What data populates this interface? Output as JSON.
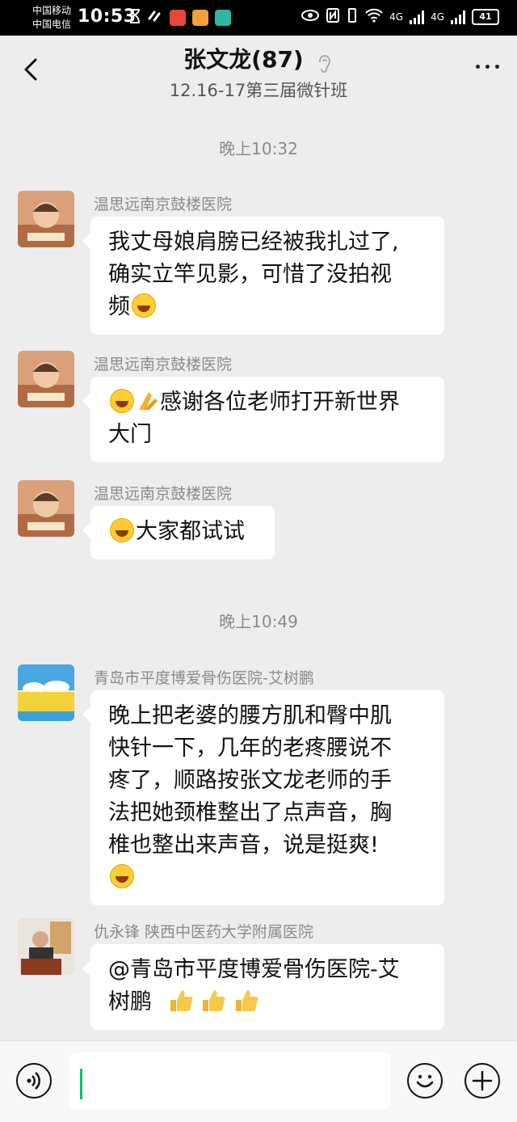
{
  "status_bar": {
    "carrier_1": "中国移动",
    "carrier_2": "中国电信",
    "time": "10:53",
    "network_1": "4G",
    "network_2": "4G",
    "battery": "41"
  },
  "header": {
    "title": "张文龙(87)",
    "subtitle": "12.16-17第三届微针班"
  },
  "timestamps": [
    "晚上10:32",
    "晚上10:49"
  ],
  "messages": [
    {
      "sender": "温思远南京鼓楼医院",
      "lines": [
        "我丈母娘肩膀已经被我扎过了,",
        "确实立竿见影，可惜了没拍视",
        "频"
      ]
    },
    {
      "sender": "温思远南京鼓楼医院",
      "lines": [
        "感谢各位老师打开新世界",
        "大门"
      ]
    },
    {
      "sender": "温思远南京鼓楼医院",
      "lines": [
        "大家都试试"
      ]
    },
    {
      "sender": "青岛市平度博爱骨伤医院-艾树鹏",
      "lines": [
        "晚上把老婆的腰方肌和臀中肌",
        "快针一下，几年的老疼腰说不",
        "疼了，顺路按张文龙老师的手",
        "法把她颈椎整出了点声音，胸",
        "椎也整出来声音，说是挺爽!"
      ]
    },
    {
      "sender": "仇永锋 陕西中医药大学附属医院",
      "lines": [
        "@青岛市平度博爱骨伤医院-艾",
        "树鹏"
      ]
    }
  ],
  "colors": {
    "accent": "#07c160",
    "background": "#ededed",
    "bubble": "#ffffff"
  }
}
